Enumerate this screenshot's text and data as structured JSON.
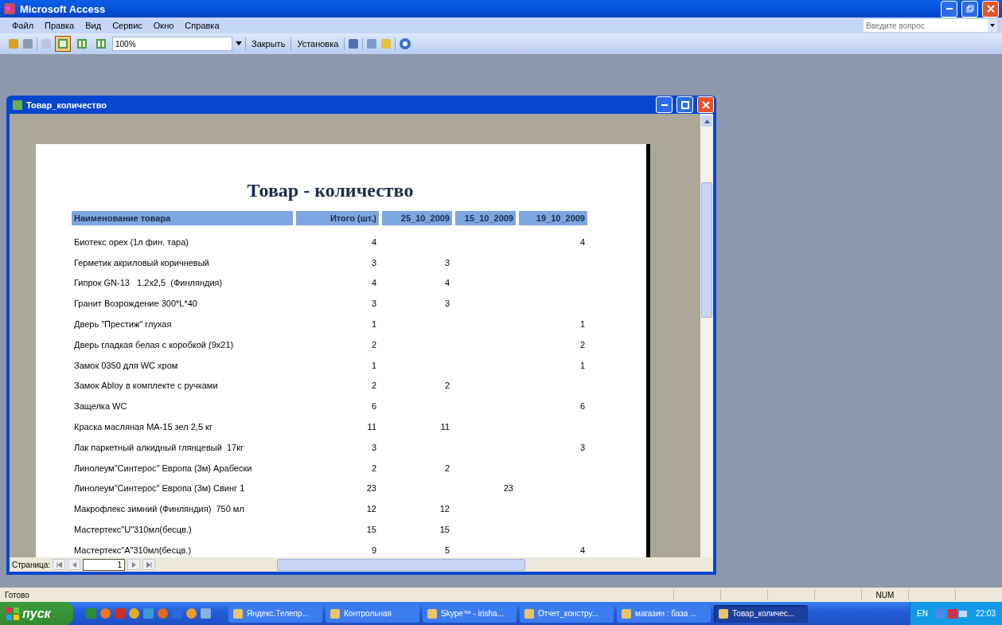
{
  "window": {
    "title": "Microsoft Access"
  },
  "menu": [
    "Файл",
    "Правка",
    "Вид",
    "Сервис",
    "Окно",
    "Справка"
  ],
  "help_box": {
    "placeholder": "Введите вопрос"
  },
  "toolbar": {
    "zoom": "100%",
    "buttons": [
      "Закрыть",
      "Установка"
    ],
    "view_modes": [
      {
        "selected": true
      },
      {
        "selected": false
      },
      {
        "selected": false
      }
    ]
  },
  "report_window": {
    "title": "Товар_количество",
    "report": {
      "title": "Товар - количество",
      "columns": [
        "Наименование товара",
        "Итого (шт.)",
        "25_10_2009",
        "15_10_2009",
        "19_10_2009"
      ],
      "rows": [
        {
          "name": "Биотекс орех (1л фин. тара)",
          "total": "4",
          "date_3": "4"
        },
        {
          "name": "Герметик акриловый коричневый",
          "total": "3",
          "date_1": "3"
        },
        {
          "name": "Гипрок GN-13   1.2x2,5  (Финляндия)",
          "total": "4",
          "date_1": "4"
        },
        {
          "name": "Гранит Возрождение 300*L*40",
          "total": "3",
          "date_1": "3"
        },
        {
          "name": "Дверь \"Престиж\" глухая",
          "total": "1",
          "date_3": "1"
        },
        {
          "name": "Дверь гладкая белая с коробкой (9х21)",
          "total": "2",
          "date_3": "2"
        },
        {
          "name": "Замок 0350 для WC хром",
          "total": "1",
          "date_3": "1"
        },
        {
          "name": "Замок Abloy в комплекте с ручками",
          "total": "2",
          "date_1": "2"
        },
        {
          "name": "Защелка WC",
          "total": "6",
          "date_3": "6"
        },
        {
          "name": "Краска масляная МА-15 зел 2,5 кг",
          "total": "11",
          "date_1": "11"
        },
        {
          "name": "Лак паркетный алкидный глянцевый  17кг",
          "total": "3",
          "date_3": "3"
        },
        {
          "name": "Линолеум\"Синтерос\" Европа (3м) Арабески",
          "total": "2",
          "date_1": "2"
        },
        {
          "name": "Линолеум\"Синтерос\" Европа (3м) Свинг 1",
          "total": "23",
          "date_2": "23"
        },
        {
          "name": "Макрофлекс зимний (Финляндия)  750 мл",
          "total": "12",
          "date_1": "12"
        },
        {
          "name": "Мастертекс\"U\"310мл(бесцв.)",
          "total": "15",
          "date_1": "15"
        },
        {
          "name": "Мастертекс\"A\"310мл(бесцв.)",
          "total": "9",
          "date_1": "5",
          "date_3": "4"
        }
      ]
    },
    "navigation": {
      "label": "Страница:",
      "page": "1"
    }
  },
  "status_bar": {
    "text": "Готово",
    "indicators": [
      "NUM"
    ]
  },
  "taskbar": {
    "start": "пуск",
    "tasks": [
      {
        "label": "Яндекс.Телепр...",
        "selected": false
      },
      {
        "label": "Контрольная",
        "selected": false
      },
      {
        "label": "Skype™ - irisha...",
        "selected": false
      },
      {
        "label": "Отчет_констру...",
        "selected": false
      },
      {
        "label": "магазин : база ...",
        "selected": false
      },
      {
        "label": "Товар_количес...",
        "selected": true
      }
    ],
    "language": "EN",
    "time": "22:03"
  }
}
